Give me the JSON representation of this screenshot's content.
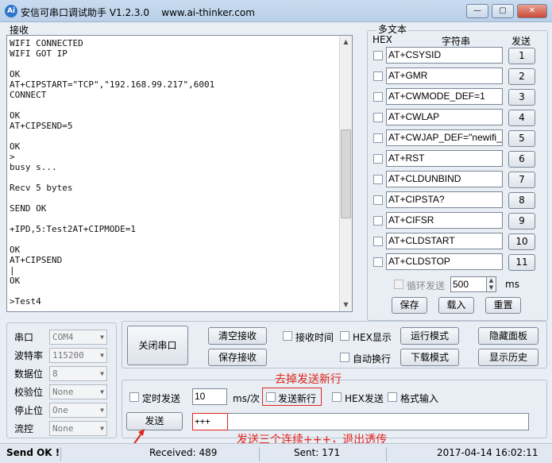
{
  "window": {
    "title": "安信可串口调试助手 V1.2.3.0",
    "url": "www.ai-thinker.com",
    "icon_text": "Ai",
    "controls": {
      "minimize": "—",
      "maximize": "▢",
      "close": "✕"
    }
  },
  "receive": {
    "legend": "接收",
    "lines": "WIFI CONNECTED\nWIFI GOT IP\n\nOK\nAT+CIPSTART=\"TCP\",\"192.168.99.217\",6001\nCONNECT\n\nOK\nAT+CIPSEND=5\n\nOK\n>\nbusy s...\n\nRecv 5 bytes\n\nSEND OK\n\n+IPD,5:Test2AT+CIPMODE=1\n\nOK\nAT+CIPSEND\n|\nOK\n\n>Test4"
  },
  "multi": {
    "legend": "多文本",
    "headers": {
      "hex": "HEX",
      "string": "字符串",
      "send": "发送"
    },
    "items": [
      {
        "text": "AT+CSYSID",
        "num": "1"
      },
      {
        "text": "AT+GMR",
        "num": "2"
      },
      {
        "text": "AT+CWMODE_DEF=1",
        "num": "3"
      },
      {
        "text": "AT+CWLAP",
        "num": "4"
      },
      {
        "text": "AT+CWJAP_DEF=\"newifi_",
        "num": "5"
      },
      {
        "text": "AT+RST",
        "num": "6"
      },
      {
        "text": "AT+CLDUNBIND",
        "num": "7"
      },
      {
        "text": "AT+CIPSTA?",
        "num": "8"
      },
      {
        "text": "AT+CIFSR",
        "num": "9"
      },
      {
        "text": "AT+CLDSTART",
        "num": "10"
      },
      {
        "text": "AT+CLDSTOP",
        "num": "11"
      }
    ],
    "loop_label": "循环发送",
    "loop_value": "500",
    "loop_unit": "ms",
    "save": "保存",
    "load": "载入",
    "reset": "重置"
  },
  "serial": {
    "port_label": "串口",
    "port_value": "COM4",
    "baud_label": "波特率",
    "baud_value": "115200",
    "data_label": "数据位",
    "data_value": "8",
    "parity_label": "校验位",
    "parity_value": "None",
    "stop_label": "停止位",
    "stop_value": "One",
    "flow_label": "流控",
    "flow_value": "None"
  },
  "controls": {
    "close_port": "关闭串口",
    "clear_recv": "清空接收",
    "save_recv": "保存接收",
    "recv_time": "接收时间",
    "hex_display": "HEX显示",
    "run_mode": "运行模式",
    "hide_panel": "隐藏面板",
    "auto_wrap": "自动换行",
    "download_mode": "下载模式",
    "show_history": "显示历史"
  },
  "send": {
    "timed_send": "定时发送",
    "interval_value": "10",
    "interval_unit": "ms/次",
    "send_newline": "发送新行",
    "hex_send": "HEX发送",
    "format_input": "格式输入",
    "send_button": "发送",
    "input_value": "+++"
  },
  "annotations": {
    "top": "去掉发送新行",
    "bottom": "发送三个连续+++，退出透传",
    "color": "#e0251c"
  },
  "status": {
    "message": "Send OK !",
    "received": "Received: 489",
    "sent": "Sent: 171",
    "datetime": "2017-04-14 16:02:11"
  }
}
